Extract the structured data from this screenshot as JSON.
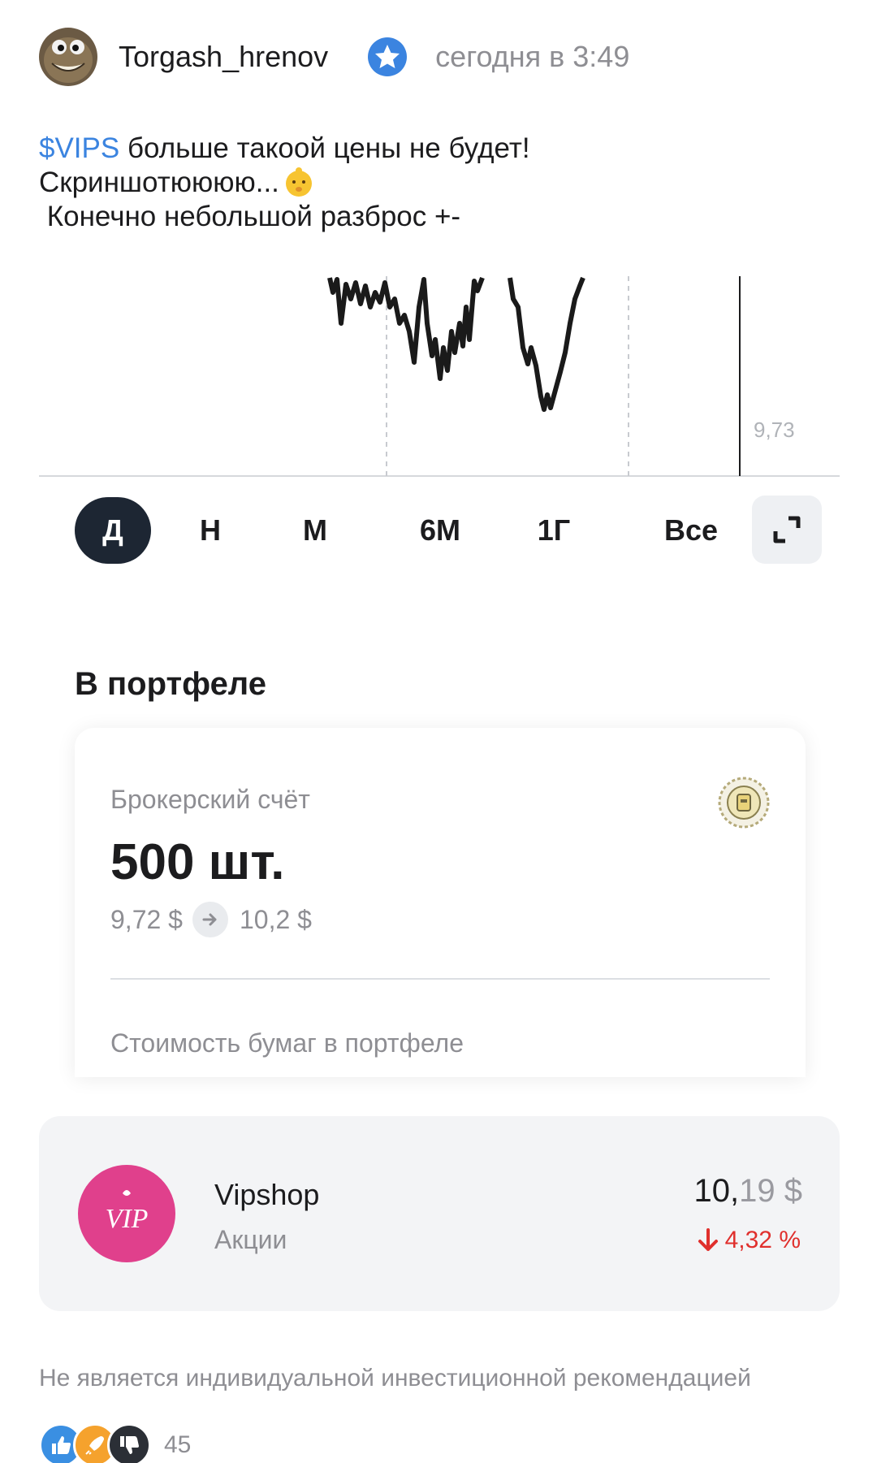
{
  "post": {
    "author": "Torgash_hrenov",
    "time": "сегодня в 3:49",
    "ticker": "$VIPS",
    "line1_rest": " больше такоой цены не будет!",
    "line2": "Скриншотюююю...",
    "line3": " Конечно небольшой разброс +-"
  },
  "chart_data": {
    "type": "line",
    "price_label": "9,73",
    "note": "Price line fragment, values not labeled; y axis unlabeled except current price"
  },
  "periods": {
    "items": [
      "Д",
      "Н",
      "М",
      "6М",
      "1Г",
      "Все"
    ],
    "active": "Д"
  },
  "portfolio": {
    "title": "В портфеле",
    "account": "Брокерский счёт",
    "quantity": "500 шт.",
    "buy_price": "9,72 $",
    "current_price": "10,2 $",
    "value_label": "Стоимость бумаг в портфеле"
  },
  "instrument": {
    "name": "Vipshop",
    "type": "Акции",
    "price_main": "10,",
    "price_dim": "19",
    "currency": " $",
    "change": "4,32 %",
    "logo_text": "VIP"
  },
  "disclaimer": "Не является индивидуальной инвестиционной рекомендацией",
  "reactions": {
    "count": "45",
    "icons": [
      "thumbs-up-icon",
      "rocket-icon",
      "thumbs-down-icon"
    ]
  },
  "colors": {
    "ticker": "#3b84e0",
    "active_period_bg": "#1d2633",
    "negative": "#e0302d",
    "vipshop": "#e0408c"
  }
}
